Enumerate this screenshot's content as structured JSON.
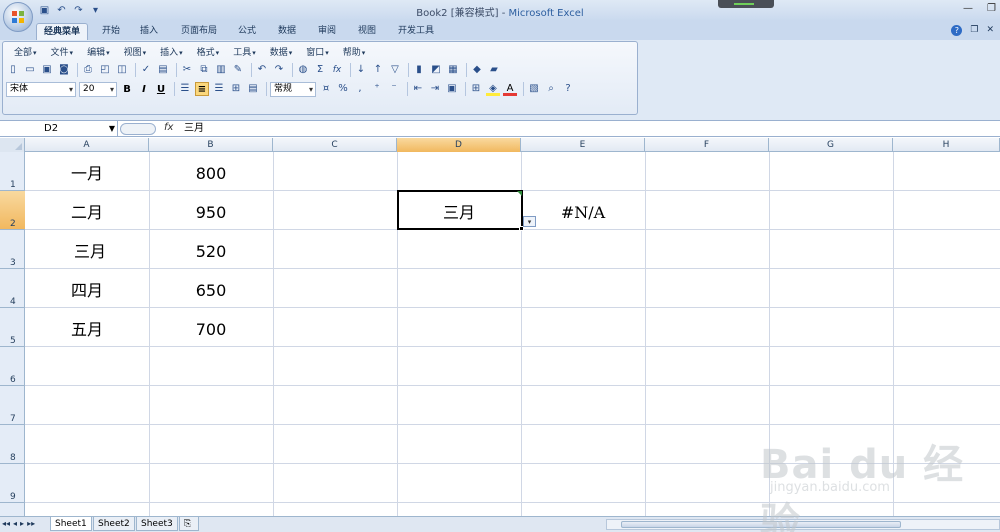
{
  "window": {
    "title_prefix": "Book2  [兼容模式] - ",
    "title_app": "Microsoft Excel"
  },
  "ribbon_tabs": [
    "经典菜单",
    "开始",
    "插入",
    "页面布局",
    "公式",
    "数据",
    "审阅",
    "视图",
    "开发工具"
  ],
  "classic_menu": [
    "全部",
    "文件",
    "编辑",
    "视图",
    "插入",
    "格式",
    "工具",
    "数据",
    "窗口",
    "帮助"
  ],
  "toolbar": {
    "font_name": "宋体",
    "font_size": "20",
    "bold": "B",
    "italic": "I",
    "underline": "U",
    "number_format": "常规",
    "sum_symbol": "Σ",
    "fx_symbol": "fx",
    "percent": "%",
    "comma": ","
  },
  "formula_bar": {
    "name_box": "D2",
    "fx_label": "fx",
    "value": "三月"
  },
  "columns": [
    "A",
    "B",
    "C",
    "D",
    "E",
    "F",
    "G",
    "H"
  ],
  "selected_column": "D",
  "rows": [
    "1",
    "2",
    "3",
    "4",
    "5",
    "6",
    "7",
    "8",
    "9"
  ],
  "selected_row": "2",
  "cells": {
    "A1": "一月",
    "B1": "800",
    "A2": "二月",
    "B2": "950",
    "A3": "三月",
    "B3": "520",
    "A4": "四月",
    "B4": "650",
    "A5": "五月",
    "B5": "700",
    "D2": "三月",
    "E2": "#N/A"
  },
  "sheets": [
    "Sheet1",
    "Sheet2",
    "Sheet3"
  ],
  "active_sheet": "Sheet1",
  "watermark": {
    "brand": "Bai du 经验",
    "url": "jingyan.baidu.com"
  },
  "colors": {
    "selection_header": "#f1b85f",
    "grid_line": "#d0d7e5",
    "ribbon_bg": "#dfe9f5",
    "error_triangle": "#2f8a3a"
  }
}
